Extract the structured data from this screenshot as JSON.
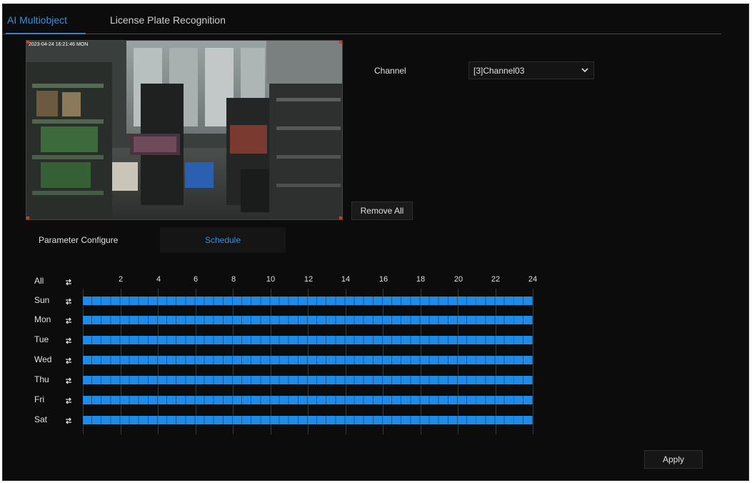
{
  "tabs": [
    {
      "label": "AI Multiobject",
      "active": true
    },
    {
      "label": "License Plate Recognition",
      "active": false
    }
  ],
  "preview": {
    "timestamp": "2023-04-24 16:21:46 MON"
  },
  "channel": {
    "label": "Channel",
    "value": "[3]Channel03"
  },
  "remove_all_label": "Remove All",
  "subtabs": {
    "parameter": "Parameter Configure",
    "schedule": "Schedule"
  },
  "schedule": {
    "all_label": "All",
    "hours": [
      "2",
      "4",
      "6",
      "8",
      "10",
      "12",
      "14",
      "16",
      "18",
      "20",
      "22",
      "24"
    ],
    "days": [
      {
        "label": "Sun",
        "coverage": [
          0,
          24
        ]
      },
      {
        "label": "Mon",
        "coverage": [
          0,
          24
        ]
      },
      {
        "label": "Tue",
        "coverage": [
          0,
          24
        ]
      },
      {
        "label": "Wed",
        "coverage": [
          0,
          24
        ]
      },
      {
        "label": "Thu",
        "coverage": [
          0,
          24
        ]
      },
      {
        "label": "Fri",
        "coverage": [
          0,
          24
        ]
      },
      {
        "label": "Sat",
        "coverage": [
          0,
          24
        ]
      }
    ],
    "bar_color": "#1f8be8"
  },
  "apply_label": "Apply",
  "colors": {
    "accent": "#2e86de",
    "background": "#0c0c0c"
  }
}
